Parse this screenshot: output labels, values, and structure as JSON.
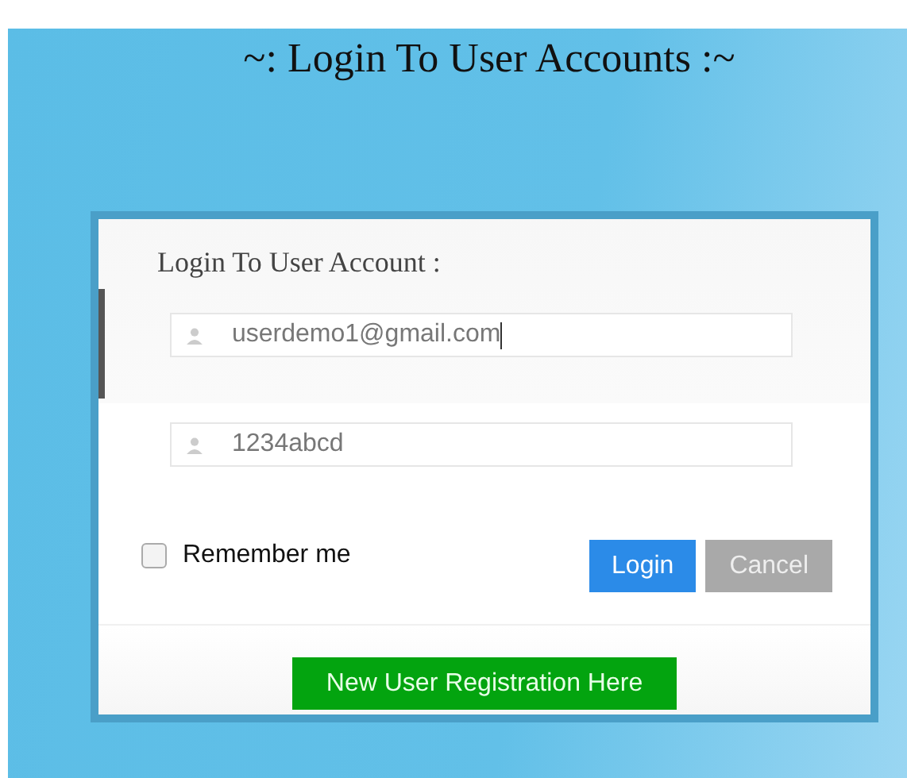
{
  "page_title": "~: Login To User Accounts :~",
  "form": {
    "heading": "Login To User Account :",
    "fields": [
      {
        "value": "userdemo1@gmail.com",
        "focused": true
      },
      {
        "value": "1234abcd",
        "focused": false
      }
    ],
    "remember": {
      "label": "Remember me",
      "checked": false
    },
    "buttons": [
      {
        "kind": "primary",
        "label": "Login"
      },
      {
        "kind": "secondary",
        "label": "Cancel"
      }
    ],
    "register_button": "New User Registration Here"
  }
}
